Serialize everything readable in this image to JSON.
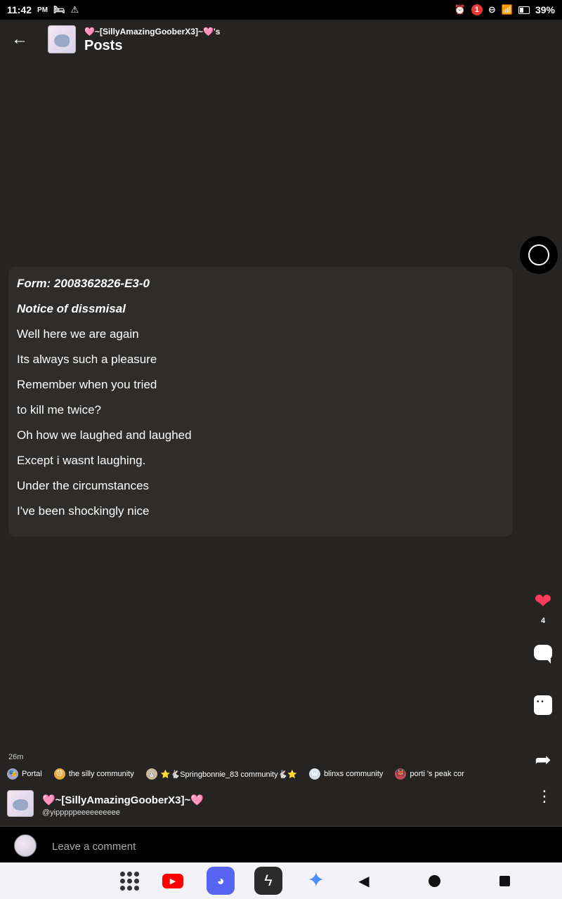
{
  "status_bar": {
    "time": "11:42",
    "ampm": "PM",
    "notification_count": "1",
    "battery": "39%"
  },
  "header": {
    "username_possessive": "🩷~[SillyAmazingGooberX3]~🩷's",
    "title": "Posts"
  },
  "post": {
    "lines": [
      "Form: 2008362826-E3-0",
      "Notice of dissmisal",
      "Well here we are again",
      "Its always such a pleasure",
      "Remember when you tried",
      "to kill me twice?",
      "Oh how we laughed and laughed",
      "Except i wasnt laughing.",
      "Under the circumstances",
      "I've been shockingly nice"
    ]
  },
  "actions": {
    "like_count": "4",
    "icons": [
      "heart-icon",
      "comment-icon",
      "sticker-icon",
      "share-icon"
    ],
    "heart_color": "#ff3b5c"
  },
  "meta": {
    "time_ago": "26m",
    "communities": [
      {
        "icon": "🎭",
        "label": "Portal"
      },
      {
        "icon": "😓",
        "label": "the silly community"
      },
      {
        "icon": "🐰",
        "label": "⭐🐇Springbonnie_83 community🐇⭐"
      },
      {
        "icon": "😺",
        "label": "blinxs community"
      },
      {
        "icon": "👹",
        "label": "porti 's peak cor"
      }
    ]
  },
  "author": {
    "name": "🩷~[SillyAmazingGooberX3]~🩷",
    "handle": "@yipppppeeeeeeeeee"
  },
  "comment_bar": {
    "placeholder": "Leave a comment"
  },
  "colors": {
    "background": "#262422",
    "card": "#2f2d2b",
    "accent_red": "#ff3b5c"
  }
}
